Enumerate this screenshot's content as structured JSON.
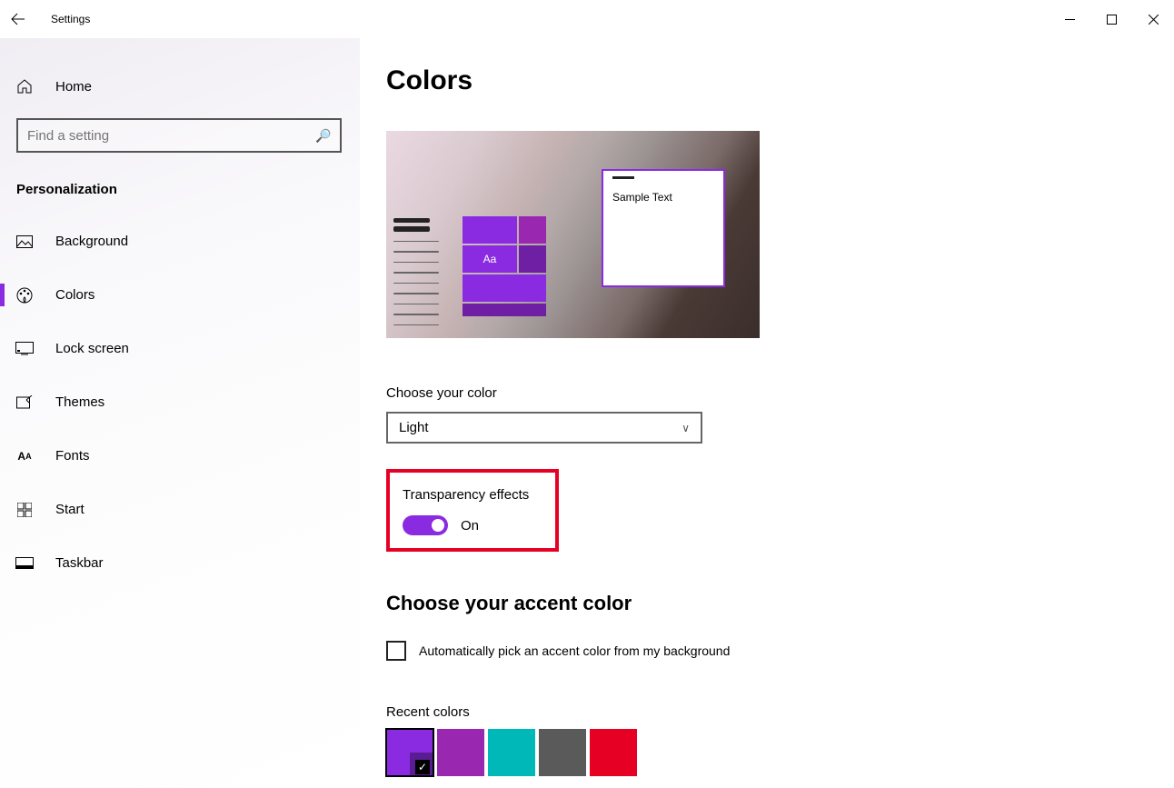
{
  "title": "Settings",
  "home_label": "Home",
  "search_placeholder": "Find a setting",
  "category": "Personalization",
  "nav": [
    {
      "icon": "picture",
      "label": "Background"
    },
    {
      "icon": "palette",
      "label": "Colors",
      "active": true
    },
    {
      "icon": "monitor",
      "label": "Lock screen"
    },
    {
      "icon": "pen",
      "label": "Themes"
    },
    {
      "icon": "font",
      "label": "Fonts"
    },
    {
      "icon": "grid",
      "label": "Start"
    },
    {
      "icon": "taskbar",
      "label": "Taskbar"
    }
  ],
  "page_title": "Colors",
  "preview_sample": "Sample Text",
  "preview_tile_label": "Aa",
  "choose_color": {
    "label": "Choose your color",
    "value": "Light"
  },
  "transparency": {
    "label": "Transparency effects",
    "state": "On"
  },
  "accent": {
    "heading": "Choose your accent color",
    "auto_label": "Automatically pick an accent color from my background",
    "recent_label": "Recent colors",
    "recent": [
      "#8a2be2",
      "#9a27b0",
      "#00b8b8",
      "#5a5a5a",
      "#e60023"
    ],
    "selected_index": 0
  }
}
